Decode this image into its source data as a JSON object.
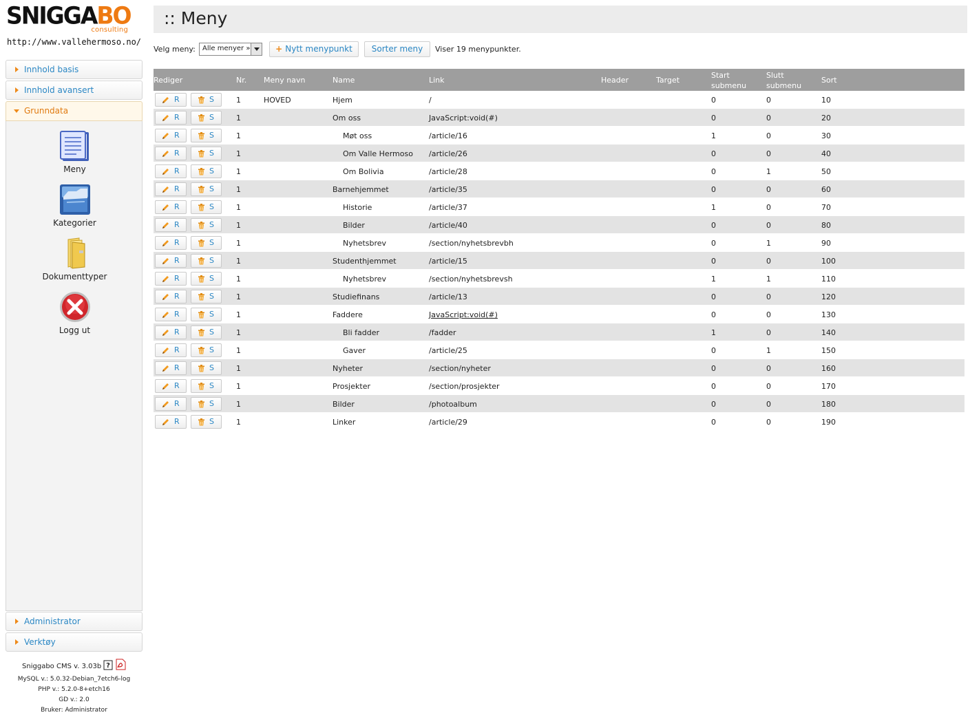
{
  "branding": {
    "logo_main": "SNIGGA",
    "logo_accent": "BO",
    "logo_sub": "consulting",
    "site_url": "http://www.vallehermoso.no/"
  },
  "sidebar": {
    "sections": [
      {
        "label": "Innhold basis"
      },
      {
        "label": "Innhold avansert"
      },
      {
        "label": "Grunndata"
      },
      {
        "label": "Administrator"
      },
      {
        "label": "Verktøy"
      }
    ],
    "tiles": [
      {
        "label": "Meny",
        "icon": "menu-document-icon"
      },
      {
        "label": "Kategorier",
        "icon": "categories-box-icon"
      },
      {
        "label": "Dokumenttyper",
        "icon": "folder-icon"
      },
      {
        "label": "Logg ut",
        "icon": "logout-x-icon"
      }
    ],
    "footer": {
      "version": "Sniggabo CMS v. 3.03b",
      "mysql": "MySQL v.: 5.0.32-Debian_7etch6-log",
      "php": "PHP v.: 5.2.0-8+etch16",
      "gd": "GD v.: 2.0",
      "user": "Bruker: Administrator"
    }
  },
  "page": {
    "title": ":: Meny",
    "menu_label": "Velg meny:",
    "menu_select_value": "Alle menyer »",
    "new_item_button": "Nytt menypunkt",
    "sort_button": "Sorter meny",
    "count_text": "Viser 19 menypunkter."
  },
  "table": {
    "headers": {
      "edit": "Rediger",
      "nr": "Nr.",
      "menu_name": "Meny navn",
      "name": "Name",
      "link": "Link",
      "header": "Header",
      "target": "Target",
      "start_a": "Start",
      "start_b": "submenu",
      "end_a": "Slutt",
      "end_b": "submenu",
      "sort": "Sort"
    },
    "edit_label": "R",
    "delete_label": "S",
    "rows": [
      {
        "nr": "1",
        "menu": "HOVED",
        "name": "Hjem",
        "sub": false,
        "link": "/",
        "start": "0",
        "end": "0",
        "sort": "10"
      },
      {
        "nr": "1",
        "menu": "",
        "name": "Om oss",
        "sub": false,
        "link": "JavaScript:void(#)",
        "start": "0",
        "end": "0",
        "sort": "20"
      },
      {
        "nr": "1",
        "menu": "",
        "name": "Møt oss",
        "sub": true,
        "link": "/article/16",
        "start": "1",
        "end": "0",
        "sort": "30"
      },
      {
        "nr": "1",
        "menu": "",
        "name": "Om Valle Hermoso",
        "sub": true,
        "link": "/article/26",
        "start": "0",
        "end": "0",
        "sort": "40"
      },
      {
        "nr": "1",
        "menu": "",
        "name": "Om Bolivia",
        "sub": true,
        "link": "/article/28",
        "start": "0",
        "end": "1",
        "sort": "50"
      },
      {
        "nr": "1",
        "menu": "",
        "name": "Barnehjemmet",
        "sub": false,
        "link": "/article/35",
        "start": "0",
        "end": "0",
        "sort": "60"
      },
      {
        "nr": "1",
        "menu": "",
        "name": "Historie",
        "sub": true,
        "link": "/article/37",
        "start": "1",
        "end": "0",
        "sort": "70"
      },
      {
        "nr": "1",
        "menu": "",
        "name": "Bilder",
        "sub": true,
        "link": "/article/40",
        "start": "0",
        "end": "0",
        "sort": "80"
      },
      {
        "nr": "1",
        "menu": "",
        "name": "Nyhetsbrev",
        "sub": true,
        "link": "/section/nyhetsbrevbh",
        "start": "0",
        "end": "1",
        "sort": "90"
      },
      {
        "nr": "1",
        "menu": "",
        "name": "Studenthjemmet",
        "sub": false,
        "link": "/article/15",
        "start": "0",
        "end": "0",
        "sort": "100"
      },
      {
        "nr": "1",
        "menu": "",
        "name": "Nyhetsbrev",
        "sub": true,
        "link": "/section/nyhetsbrevsh",
        "start": "1",
        "end": "1",
        "sort": "110"
      },
      {
        "nr": "1",
        "menu": "",
        "name": "Studiefinans",
        "sub": false,
        "link": "/article/13",
        "start": "0",
        "end": "0",
        "sort": "120"
      },
      {
        "nr": "1",
        "menu": "",
        "name": "Faddere",
        "sub": false,
        "link": "JavaScript:void(#)",
        "underline": true,
        "start": "0",
        "end": "0",
        "sort": "130"
      },
      {
        "nr": "1",
        "menu": "",
        "name": "Bli fadder",
        "sub": true,
        "link": "/fadder",
        "start": "1",
        "end": "0",
        "sort": "140"
      },
      {
        "nr": "1",
        "menu": "",
        "name": "Gaver",
        "sub": true,
        "link": "/article/25",
        "start": "0",
        "end": "1",
        "sort": "150"
      },
      {
        "nr": "1",
        "menu": "",
        "name": "Nyheter",
        "sub": false,
        "link": "/section/nyheter",
        "start": "0",
        "end": "0",
        "sort": "160"
      },
      {
        "nr": "1",
        "menu": "",
        "name": "Prosjekter",
        "sub": false,
        "link": "/section/prosjekter",
        "start": "0",
        "end": "0",
        "sort": "170"
      },
      {
        "nr": "1",
        "menu": "",
        "name": "Bilder",
        "sub": false,
        "link": "/photoalbum",
        "start": "0",
        "end": "0",
        "sort": "180"
      },
      {
        "nr": "1",
        "menu": "",
        "name": "Linker",
        "sub": false,
        "link": "/article/29",
        "start": "0",
        "end": "0",
        "sort": "190"
      }
    ]
  }
}
